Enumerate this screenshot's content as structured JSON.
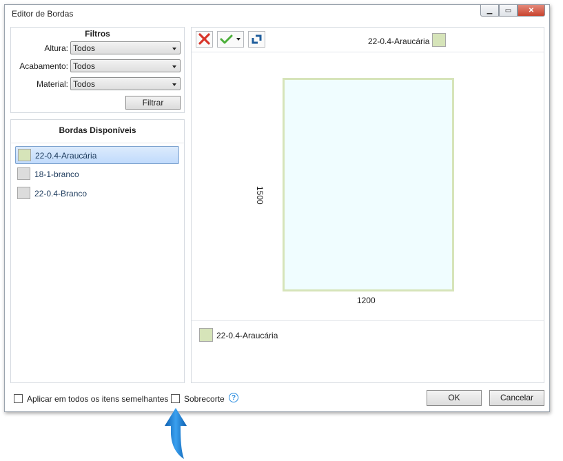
{
  "window": {
    "title": "Editor de Bordas"
  },
  "colors": {
    "swatch_araucaria": "#d6e4b9",
    "swatch_neutral": "#dcdcdc",
    "accent": "#2a8de0"
  },
  "filters": {
    "title": "Filtros",
    "altura": {
      "label": "Altura:",
      "value": "Todos"
    },
    "acabamento": {
      "label": "Acabamento:",
      "value": "Todos"
    },
    "material": {
      "label": "Material:",
      "value": "Todos"
    },
    "filter_button": "Filtrar"
  },
  "available": {
    "title": "Bordas Disponíveis",
    "items": [
      {
        "label": "22-0.4-Araucária",
        "selected": true
      },
      {
        "label": "18-1-branco",
        "selected": false
      },
      {
        "label": "22-0.4-Branco",
        "selected": false
      }
    ]
  },
  "editor": {
    "top_label": "22-0.4-Araucária",
    "width_label": "1200",
    "height_label": "1500",
    "bottom_label": "22-0.4-Araucária"
  },
  "footer": {
    "apply_all_label": "Aplicar em todos os itens semelhantes",
    "apply_all_checked": false,
    "sobrecorte_label": "Sobrecorte",
    "sobrecorte_checked": false,
    "ok_label": "OK",
    "cancel_label": "Cancelar"
  }
}
